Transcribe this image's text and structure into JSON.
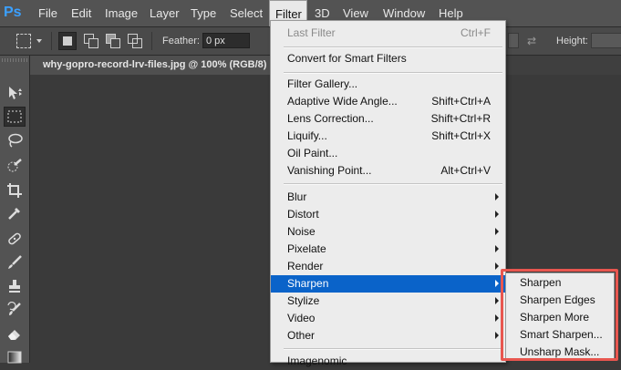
{
  "app": {
    "logo": "Ps"
  },
  "menubar": {
    "items": [
      "File",
      "Edit",
      "Image",
      "Layer",
      "Type",
      "Select",
      "Filter",
      "3D",
      "View",
      "Window",
      "Help"
    ],
    "active": "Filter"
  },
  "options": {
    "feather_label": "Feather:",
    "feather_value": "0 px",
    "height_label": "Height:"
  },
  "document": {
    "tab_title": "why-gopro-record-lrv-files.jpg @ 100% (RGB/8)"
  },
  "tools": [
    "move-tool-icon",
    "marquee-tool-icon",
    "lasso-tool-icon",
    "quick-selection-tool-icon",
    "crop-tool-icon",
    "eyedropper-tool-icon",
    "healing-brush-tool-icon",
    "brush-tool-icon",
    "clone-stamp-tool-icon",
    "history-brush-tool-icon",
    "eraser-tool-icon",
    "gradient-tool-icon"
  ],
  "filter_menu": {
    "last_filter": {
      "label": "Last Filter",
      "shortcut": "Ctrl+F"
    },
    "convert_smart": {
      "label": "Convert for Smart Filters"
    },
    "filter_gallery": {
      "label": "Filter Gallery..."
    },
    "adaptive_wide_angle": {
      "label": "Adaptive Wide Angle...",
      "shortcut": "Shift+Ctrl+A"
    },
    "lens_correction": {
      "label": "Lens Correction...",
      "shortcut": "Shift+Ctrl+R"
    },
    "liquify": {
      "label": "Liquify...",
      "shortcut": "Shift+Ctrl+X"
    },
    "oil_paint": {
      "label": "Oil Paint..."
    },
    "vanishing_point": {
      "label": "Vanishing Point...",
      "shortcut": "Alt+Ctrl+V"
    },
    "blur": {
      "label": "Blur"
    },
    "distort": {
      "label": "Distort"
    },
    "noise": {
      "label": "Noise"
    },
    "pixelate": {
      "label": "Pixelate"
    },
    "render": {
      "label": "Render"
    },
    "sharpen": {
      "label": "Sharpen"
    },
    "stylize": {
      "label": "Stylize"
    },
    "video": {
      "label": "Video"
    },
    "other": {
      "label": "Other"
    },
    "imagenomic": {
      "label": "Imagenomic"
    }
  },
  "sharpen_submenu": {
    "sharpen": "Sharpen",
    "sharpen_edges": "Sharpen Edges",
    "sharpen_more": "Sharpen More",
    "smart_sharpen": "Smart Sharpen...",
    "unsharp_mask": "Unsharp Mask..."
  },
  "colors": {
    "menu_highlight": "#0a63c9",
    "annotation_border": "#e8564f",
    "logo": "#3ba0ff"
  }
}
